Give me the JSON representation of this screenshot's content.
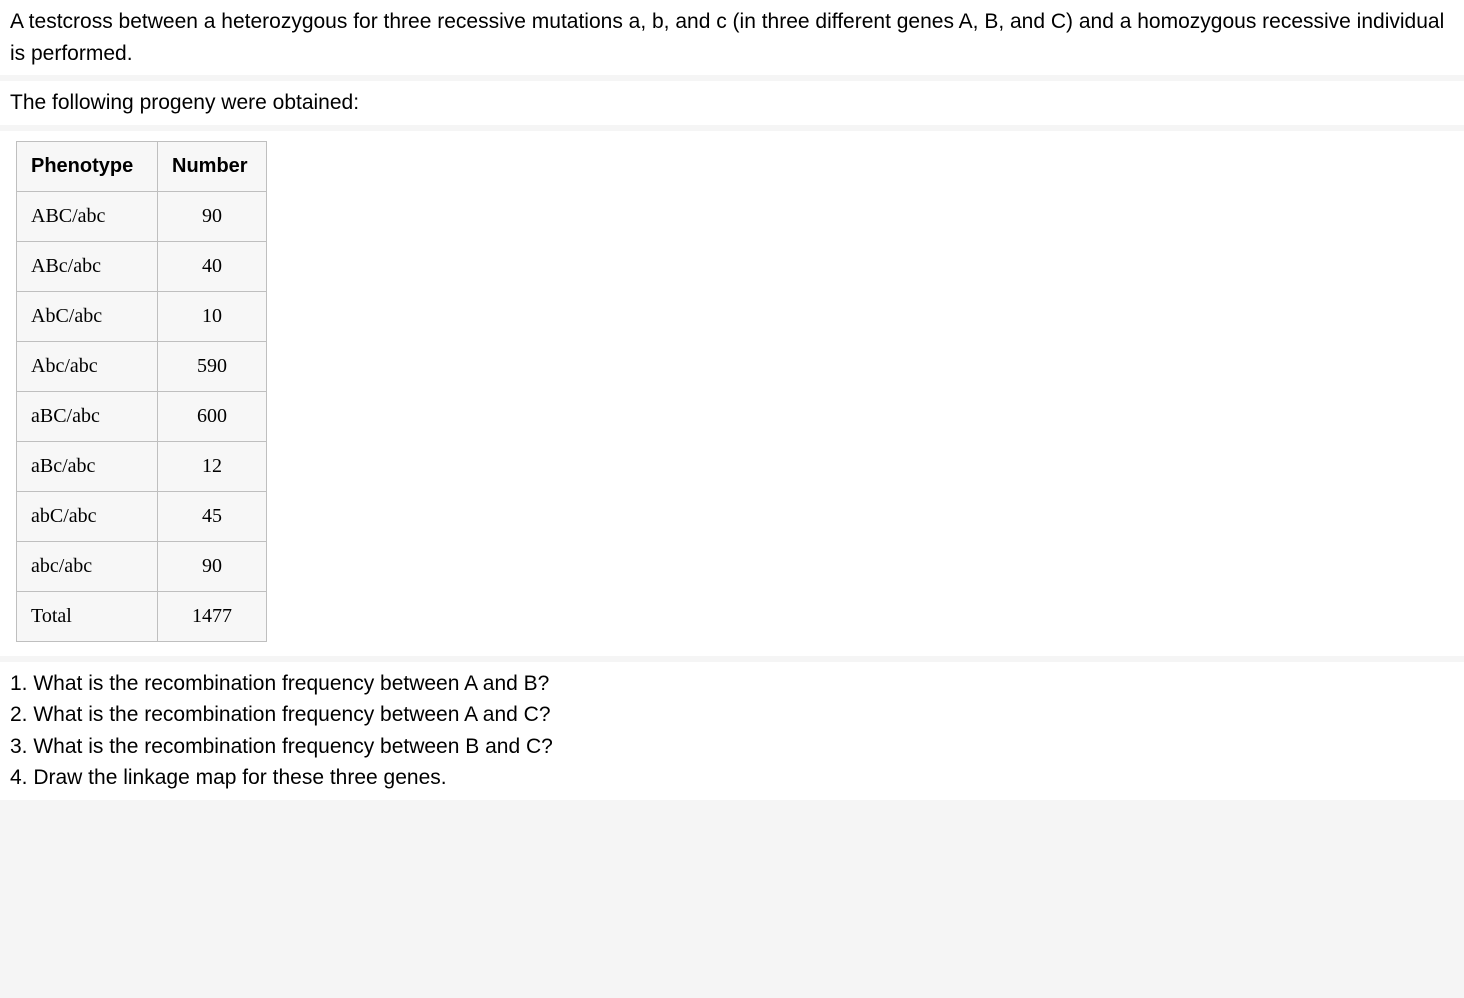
{
  "intro1": "A testcross between a heterozygous for three recessive mutations a, b, and c  (in three different genes A, B, and C) and a homozygous recessive individual is performed.",
  "intro2": "The following progeny were obtained:",
  "table": {
    "headers": {
      "c0": "Phenotype",
      "c1": "Number"
    },
    "rows": [
      {
        "pheno": "ABC/abc",
        "num": "90"
      },
      {
        "pheno": "ABc/abc",
        "num": "40"
      },
      {
        "pheno": "AbC/abc",
        "num": "10"
      },
      {
        "pheno": "Abc/abc",
        "num": "590"
      },
      {
        "pheno": "aBC/abc",
        "num": "600"
      },
      {
        "pheno": "aBc/abc",
        "num": "12"
      },
      {
        "pheno": "abC/abc",
        "num": "45"
      },
      {
        "pheno": "abc/abc",
        "num": "90"
      },
      {
        "pheno": "Total",
        "num": "1477"
      }
    ]
  },
  "questions": {
    "q1": "1. What is the recombination frequency between A and B?",
    "q2": "2. What is the recombination frequency between A and C?",
    "q3": "3. What is the recombination frequency between B and C?",
    "q4": "4. Draw the linkage map for these three genes."
  }
}
